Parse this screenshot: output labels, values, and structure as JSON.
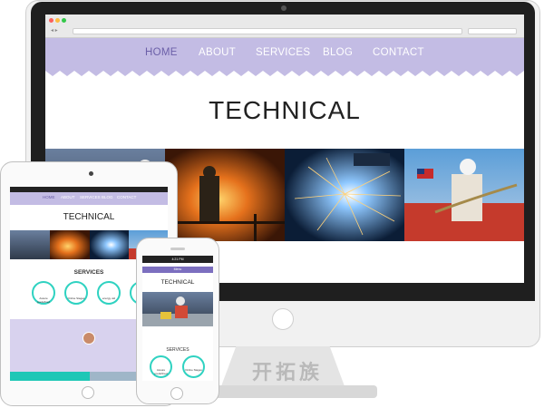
{
  "site": {
    "nav": [
      {
        "label": "HOME",
        "active": true
      },
      {
        "label": "ABOUT",
        "active": false
      },
      {
        "label": "SERVICES",
        "active": false
      },
      {
        "label": "BLOG",
        "active": false
      },
      {
        "label": "CONTACT",
        "active": false
      }
    ],
    "title": "TECHNICAL",
    "services_heading": "SERVICES",
    "service_items": [
      "Assure predefined",
      "Online Stages",
      "energy utd",
      "Create"
    ],
    "phone_menu": "Menu",
    "phone_status_time": "4:21 PM"
  },
  "watermark": "开拓族",
  "colors": {
    "nav_background": "#c3bce4",
    "nav_active": "#6b5fa8",
    "accent_teal": "#2fd2c1",
    "phone_menu_bar": "#7c6fbf"
  },
  "photos": [
    "worker-on-rail-photo",
    "steel-foundry-photo",
    "welding-sparks-photo",
    "worker-with-chains-photo"
  ]
}
